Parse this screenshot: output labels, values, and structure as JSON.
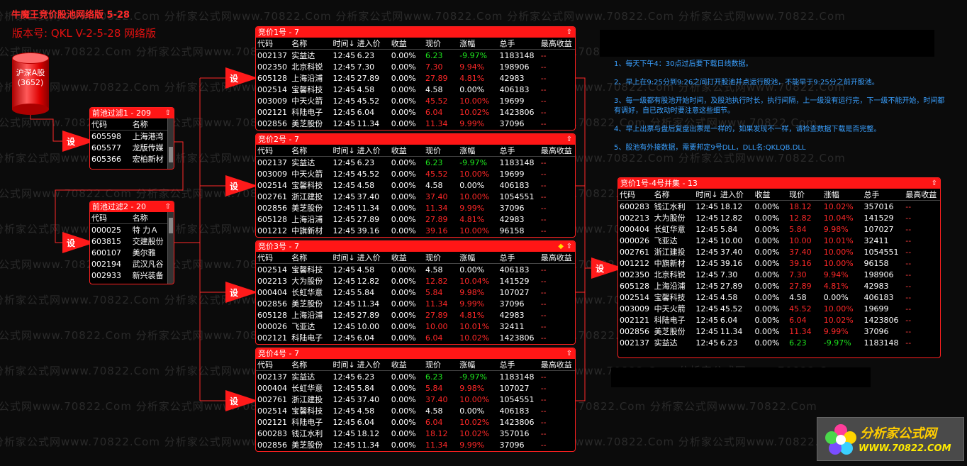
{
  "header": {
    "title": "牛魔王竞价股池网络版 5-28",
    "version": "版本号:  QKL V-2-5-28 网络版"
  },
  "database": {
    "label": "沪深A股",
    "count": "(3652)"
  },
  "node_label": "设",
  "watermark": "分析家公式网www.70822.Com 分析家公式网www.70822.Com 分析家公式网www.70822.Com 分析家公式网www.70822.Com 分析家公式网www.70822.Com",
  "filter1": {
    "title": "前池过滤1 - 209",
    "cols": [
      "代码",
      "名称"
    ],
    "rows": [
      [
        "605598",
        "上海港湾"
      ],
      [
        "605577",
        "龙版传媒"
      ],
      [
        "605366",
        "宏柏新材"
      ]
    ]
  },
  "filter2": {
    "title": "前池过滤2 - 20",
    "cols": [
      "代码",
      "名称"
    ],
    "rows": [
      [
        "000025",
        "特 力Ａ"
      ],
      [
        "603815",
        "交建股份"
      ],
      [
        "600107",
        "美尔雅"
      ],
      [
        "002194",
        "武汉凡谷"
      ],
      [
        "002933",
        "新兴装备"
      ]
    ]
  },
  "cols": [
    "代码",
    "名称",
    "时间↓",
    "进入价",
    "收益",
    "现价",
    "涨幅",
    "总手",
    "最高收益"
  ],
  "panel1": {
    "title": "竞价1号 - 7",
    "rows": [
      [
        "002137",
        "实益达",
        "12:45",
        "6.23",
        "0.00%",
        "6.23",
        "-9.97%",
        "1183148",
        "--"
      ],
      [
        "002350",
        "北京科锐",
        "12:45",
        "7.30",
        "0.00%",
        "7.30",
        "9.94%",
        "198906",
        "--"
      ],
      [
        "605128",
        "上海沿浦",
        "12:45",
        "27.89",
        "0.00%",
        "27.89",
        "4.81%",
        "42983",
        "--"
      ],
      [
        "002514",
        "宝馨科技",
        "12:45",
        "4.58",
        "0.00%",
        "4.58",
        "0.00%",
        "406183",
        "--"
      ],
      [
        "003009",
        "中天火箭",
        "12:45",
        "45.52",
        "0.00%",
        "45.52",
        "10.00%",
        "19699",
        "--"
      ],
      [
        "002121",
        "科陆电子",
        "12:45",
        "6.04",
        "0.00%",
        "6.04",
        "10.02%",
        "1423806",
        "--"
      ],
      [
        "002856",
        "美芝股份",
        "12:45",
        "11.34",
        "0.00%",
        "11.34",
        "9.99%",
        "37096",
        "--"
      ]
    ]
  },
  "panel2": {
    "title": "竞价2号 - 7",
    "rows": [
      [
        "002137",
        "实益达",
        "12:45",
        "6.23",
        "0.00%",
        "6.23",
        "-9.97%",
        "1183148",
        "--"
      ],
      [
        "003009",
        "中天火箭",
        "12:45",
        "45.52",
        "0.00%",
        "45.52",
        "10.00%",
        "19699",
        "--"
      ],
      [
        "002514",
        "宝馨科技",
        "12:45",
        "4.58",
        "0.00%",
        "4.58",
        "0.00%",
        "406183",
        "--"
      ],
      [
        "002761",
        "浙江建投",
        "12:45",
        "37.40",
        "0.00%",
        "37.40",
        "10.00%",
        "1054551",
        "--"
      ],
      [
        "002856",
        "美芝股份",
        "12:45",
        "11.34",
        "0.00%",
        "11.34",
        "9.99%",
        "37096",
        "--"
      ],
      [
        "605128",
        "上海沿浦",
        "12:45",
        "27.89",
        "0.00%",
        "27.89",
        "4.81%",
        "42983",
        "--"
      ],
      [
        "001212",
        "中旗新材",
        "12:45",
        "39.16",
        "0.00%",
        "39.16",
        "10.00%",
        "96158",
        "--"
      ]
    ]
  },
  "panel3": {
    "title": "竞价3号 - 7",
    "rows": [
      [
        "002514",
        "宝馨科技",
        "12:45",
        "4.58",
        "0.00%",
        "4.58",
        "0.00%",
        "406183",
        "--"
      ],
      [
        "002213",
        "大为股份",
        "12:45",
        "12.82",
        "0.00%",
        "12.82",
        "10.04%",
        "141529",
        "--"
      ],
      [
        "000404",
        "长虹华意",
        "12:45",
        "5.84",
        "0.00%",
        "5.84",
        "9.98%",
        "107027",
        "--"
      ],
      [
        "002856",
        "美芝股份",
        "12:45",
        "11.34",
        "0.00%",
        "11.34",
        "9.99%",
        "37096",
        "--"
      ],
      [
        "605128",
        "上海沿浦",
        "12:45",
        "27.89",
        "0.00%",
        "27.89",
        "4.81%",
        "42983",
        "--"
      ],
      [
        "000026",
        "飞亚达",
        "12:45",
        "10.00",
        "0.00%",
        "10.00",
        "10.01%",
        "32411",
        "--"
      ],
      [
        "002121",
        "科陆电子",
        "12:45",
        "6.04",
        "0.00%",
        "6.04",
        "10.02%",
        "1423806",
        "--"
      ]
    ]
  },
  "panel4": {
    "title": "竞价4号 - 7",
    "rows": [
      [
        "002137",
        "实益达",
        "12:45",
        "6.23",
        "0.00%",
        "6.23",
        "-9.97%",
        "1183148",
        "--"
      ],
      [
        "000404",
        "长虹华意",
        "12:45",
        "5.84",
        "0.00%",
        "5.84",
        "9.98%",
        "107027",
        "--"
      ],
      [
        "002761",
        "浙江建投",
        "12:45",
        "37.40",
        "0.00%",
        "37.40",
        "10.00%",
        "1054551",
        "--"
      ],
      [
        "002514",
        "宝馨科技",
        "12:45",
        "4.58",
        "0.00%",
        "4.58",
        "0.00%",
        "406183",
        "--"
      ],
      [
        "002121",
        "科陆电子",
        "12:45",
        "6.04",
        "0.00%",
        "6.04",
        "10.02%",
        "1423806",
        "--"
      ],
      [
        "600283",
        "钱江水利",
        "12:45",
        "18.12",
        "0.00%",
        "18.12",
        "10.02%",
        "357016",
        "--"
      ],
      [
        "002856",
        "美芝股份",
        "12:45",
        "11.34",
        "0.00%",
        "11.34",
        "9.99%",
        "37096",
        "--"
      ]
    ]
  },
  "merge": {
    "title": "竞价1号-4号并集 - 13",
    "rows": [
      [
        "600283",
        "钱江水利",
        "12:45",
        "18.12",
        "0.00%",
        "18.12",
        "10.02%",
        "357016",
        "--"
      ],
      [
        "002213",
        "大为股份",
        "12:45",
        "12.82",
        "0.00%",
        "12.82",
        "10.04%",
        "141529",
        "--"
      ],
      [
        "000404",
        "长虹华意",
        "12:45",
        "5.84",
        "0.00%",
        "5.84",
        "9.98%",
        "107027",
        "--"
      ],
      [
        "000026",
        "飞亚达",
        "12:45",
        "10.00",
        "0.00%",
        "10.00",
        "10.01%",
        "32411",
        "--"
      ],
      [
        "002761",
        "浙江建投",
        "12:45",
        "37.40",
        "0.00%",
        "37.40",
        "10.00%",
        "1054551",
        "--"
      ],
      [
        "001212",
        "中旗新材",
        "12:45",
        "39.16",
        "0.00%",
        "39.16",
        "10.00%",
        "96158",
        "--"
      ],
      [
        "002350",
        "北京科锐",
        "12:45",
        "7.30",
        "0.00%",
        "7.30",
        "9.94%",
        "198906",
        "--"
      ],
      [
        "605128",
        "上海沿浦",
        "12:45",
        "27.89",
        "0.00%",
        "27.89",
        "4.81%",
        "42983",
        "--"
      ],
      [
        "002514",
        "宝馨科技",
        "12:45",
        "4.58",
        "0.00%",
        "4.58",
        "0.00%",
        "406183",
        "--"
      ],
      [
        "003009",
        "中天火箭",
        "12:45",
        "45.52",
        "0.00%",
        "45.52",
        "10.00%",
        "19699",
        "--"
      ],
      [
        "002121",
        "科陆电子",
        "12:45",
        "6.04",
        "0.00%",
        "6.04",
        "10.02%",
        "1423806",
        "--"
      ],
      [
        "002856",
        "美芝股份",
        "12:45",
        "11.34",
        "0.00%",
        "11.34",
        "9.99%",
        "37096",
        "--"
      ],
      [
        "002137",
        "实益达",
        "12:45",
        "6.23",
        "0.00%",
        "6.23",
        "-9.97%",
        "1183148",
        "--"
      ]
    ]
  },
  "notes": [
    "1、每天下午4：30点过后要下载日线数据。",
    "2、早上在9:25分到9:26之间打开股池并点运行股池，不能早于9:25分之前开股池。",
    "3、每一级都有股池开始时间，及股池执行时长，执行间隔，上一级没有运行完，下一级不能开始，时间都有调好，自已改动时要注意这些细节。",
    "4、早上出票与盘后复盘出票是一样的，如果发现不一样，请检查数据下载是否完整。",
    "5、股池有外接数据，需要邦定9号DLL，DLL名:QKLQB.DLL"
  ],
  "logo": {
    "name": "分析家公式网",
    "url": "WWW.70822.COM"
  },
  "colors": {
    "accent": "#ff1616",
    "up": "#ff2828",
    "down": "#1ee61e",
    "note": "#3aa0ff"
  }
}
